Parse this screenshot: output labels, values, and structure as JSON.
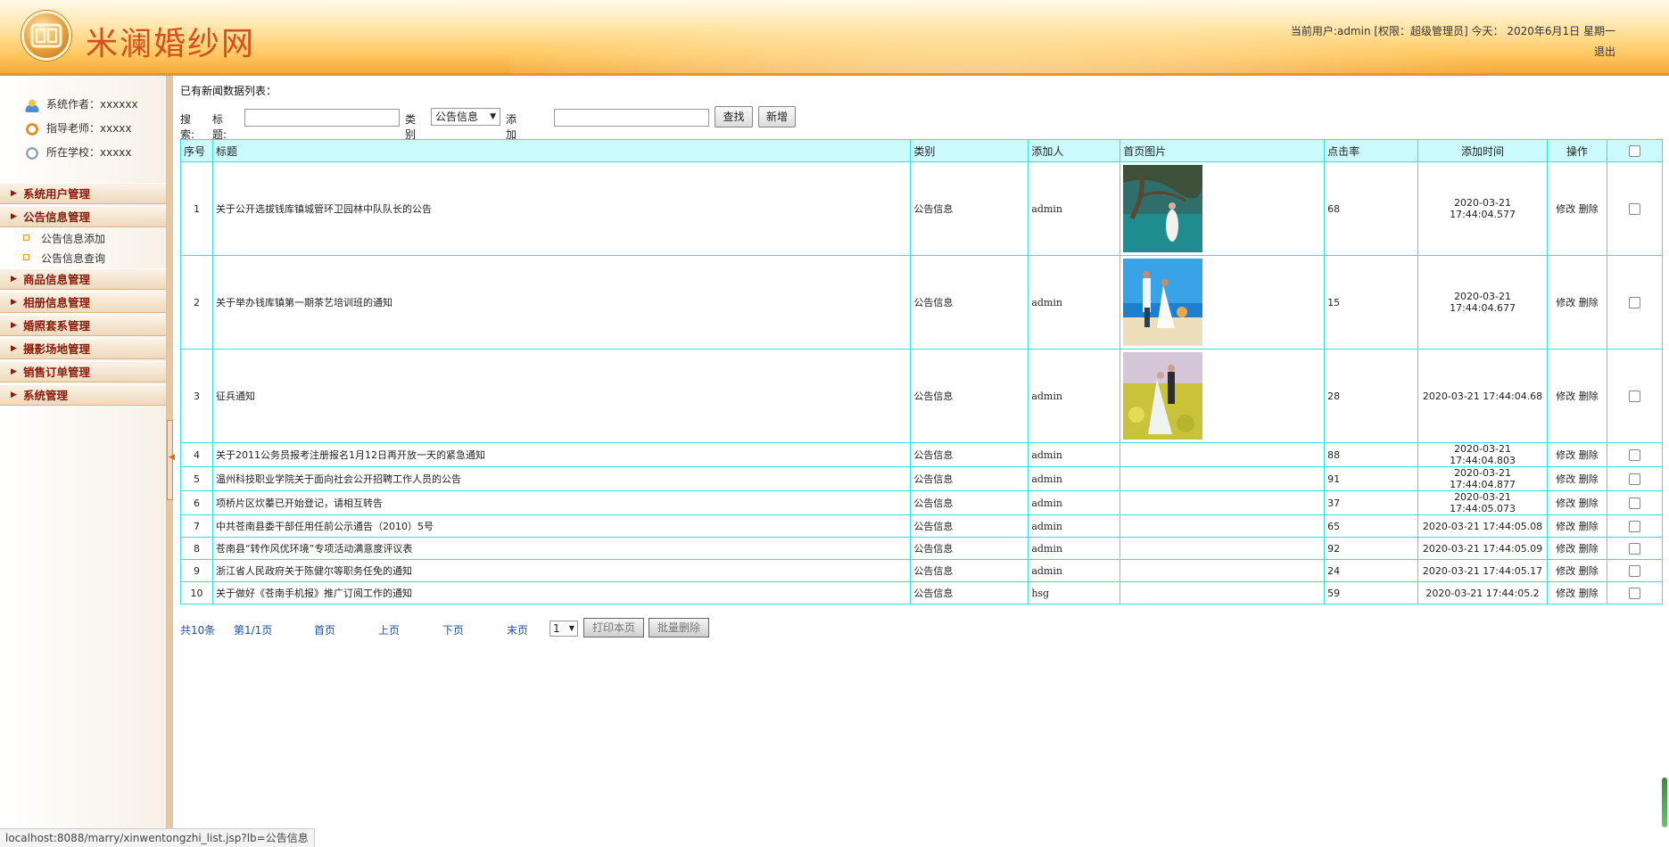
{
  "header": {
    "site_title": "米澜婚纱网",
    "user_info": "当前用户:admin [权限：超级管理员] 今天： 2020年6月1日 星期一",
    "logout_label": "退出"
  },
  "sidebar": {
    "info": [
      {
        "label": "系统作者：xxxxxx"
      },
      {
        "label": "指导老师：xxxxx"
      },
      {
        "label": "所在学校：xxxxx"
      }
    ],
    "menu": [
      {
        "label": "系统用户管理"
      },
      {
        "label": "公告信息管理"
      },
      {
        "label": "商品信息管理"
      },
      {
        "label": "相册信息管理"
      },
      {
        "label": "婚照套系管理"
      },
      {
        "label": "摄影场地管理"
      },
      {
        "label": "销售订单管理"
      },
      {
        "label": "系统管理"
      }
    ],
    "submenu": [
      {
        "label": "公告信息添加"
      },
      {
        "label": "公告信息查询"
      }
    ]
  },
  "main": {
    "heading": "已有新闻数据列表：",
    "search": {
      "label": "搜索:",
      "title_label": "标题:",
      "title_value": "",
      "category_label": "类别",
      "category_value": "公告信息",
      "adder_label": "添加人:",
      "adder_value": "",
      "search_button": "查找",
      "add_button": "新增"
    },
    "table": {
      "headers": [
        "序号",
        "标题",
        "类别",
        "添加人",
        "首页图片",
        "点击率",
        "添加时间",
        "操作"
      ],
      "edit_label": "修改",
      "delete_label": "删除",
      "rows": [
        {
          "no": "1",
          "title": "关于公开选拔钱库镇城管环卫园林中队队长的公告",
          "category": "公告信息",
          "adder": "admin",
          "image": "bride-tree-photo",
          "clicks": "68",
          "time": "2020-03-21 17:44:04.577"
        },
        {
          "no": "2",
          "title": "关于举办钱库镇第一期茶艺培训班的通知",
          "category": "公告信息",
          "adder": "admin",
          "image": "couple-beach-photo",
          "clicks": "15",
          "time": "2020-03-21 17:44:04.677"
        },
        {
          "no": "3",
          "title": "征兵通知",
          "category": "公告信息",
          "adder": "admin",
          "image": "couple-flower-field-photo",
          "clicks": "28",
          "time": "2020-03-21 17:44:04.68"
        },
        {
          "no": "4",
          "title": "关于2011公务员报考注册报名1月12日再开放一天的紧急通知",
          "category": "公告信息",
          "adder": "admin",
          "image": "",
          "clicks": "88",
          "time": "2020-03-21 17:44:04.803"
        },
        {
          "no": "5",
          "title": "温州科技职业学院关于面向社会公开招聘工作人员的公告",
          "category": "公告信息",
          "adder": "admin",
          "image": "",
          "clicks": "91",
          "time": "2020-03-21 17:44:04.877"
        },
        {
          "no": "6",
          "title": "项桥片区炊蓁已开始登记，请相互转告",
          "category": "公告信息",
          "adder": "admin",
          "image": "",
          "clicks": "37",
          "time": "2020-03-21 17:44:05.073"
        },
        {
          "no": "7",
          "title": "中共苍南县委干部任用任前公示通告（2010）5号",
          "category": "公告信息",
          "adder": "admin",
          "image": "",
          "clicks": "65",
          "time": "2020-03-21 17:44:05.08"
        },
        {
          "no": "8",
          "title": "苍南县“转作风优环境”专项活动满意度评议表",
          "category": "公告信息",
          "adder": "admin",
          "image": "",
          "clicks": "92",
          "time": "2020-03-21 17:44:05.09"
        },
        {
          "no": "9",
          "title": "浙江省人民政府关于陈健尔等职务任免的通知",
          "category": "公告信息",
          "adder": "admin",
          "image": "",
          "clicks": "24",
          "time": "2020-03-21 17:44:05.17"
        },
        {
          "no": "10",
          "title": "关于做好《苍南手机报》推广订阅工作的通知",
          "category": "公告信息",
          "adder": "hsg",
          "image": "",
          "clicks": "59",
          "time": "2020-03-21 17:44:05.2"
        }
      ]
    },
    "pager": {
      "total": "共10条",
      "page": "第1/1页",
      "first": "首页",
      "prev": "上页",
      "next": "下页",
      "last": "末页",
      "select_value": "1",
      "print_button": "打印本页",
      "batch_delete_button": "批量删除"
    }
  },
  "statusbar": {
    "url": "localhost:8088/marry/xinwentongzhi_list.jsp?lb=公告信息"
  },
  "colors": {
    "table_border": "#33e0e8",
    "table_header_bg": "#ccfbfd",
    "menu_text": "#8a1a0a",
    "title_color": "#d54f1e"
  }
}
